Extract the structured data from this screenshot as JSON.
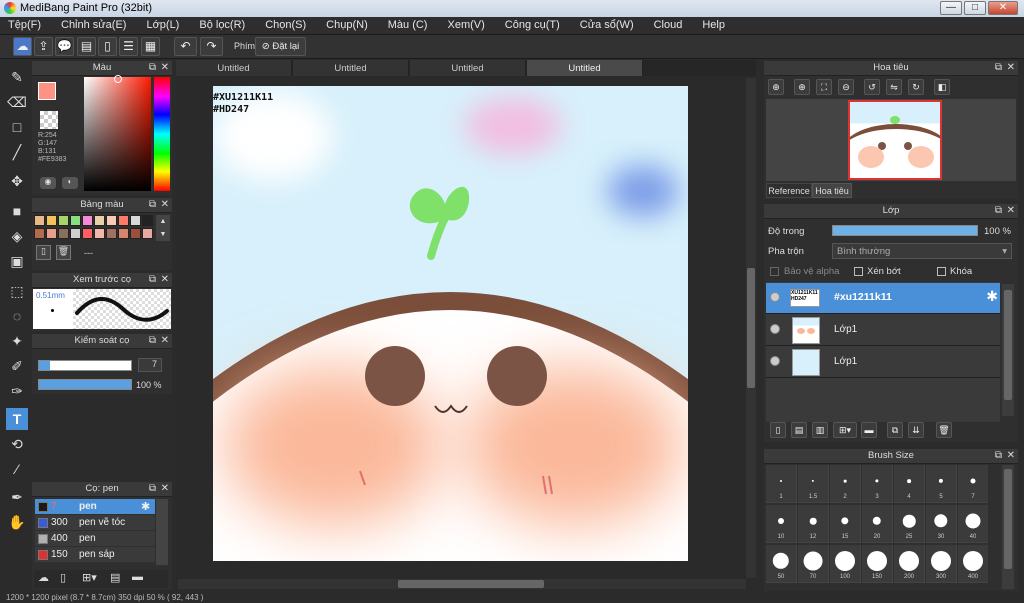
{
  "window": {
    "title": "MediBang Paint Pro (32bit)",
    "min": "—",
    "max": "□",
    "close": "✕"
  },
  "menu": [
    "Tệp(F)",
    "Chỉnh sửa(E)",
    "Lớp(L)",
    "Bộ lọc(R)",
    "Chọn(S)",
    "Chụp(N)",
    "Màu (C)",
    "Xem(V)",
    "Công cụ(T)",
    "Cửa sổ(W)",
    "Cloud",
    "Help"
  ],
  "toolbar": {
    "hotkey_label": "Phím",
    "reset_label": "Đặt lại"
  },
  "tabs": [
    "Untitled",
    "Untitled",
    "Untitled",
    "Untitled"
  ],
  "color_panel": {
    "title": "Màu",
    "r": "R:254",
    "g": "G:147",
    "b": "B:131",
    "hex": "#FE9383",
    "fg": "#FE9383"
  },
  "palette_panel": {
    "title": "Bảng màu",
    "name": "---",
    "colors": [
      "#e8b88a",
      "#f2c35a",
      "#a6d36a",
      "#85e17f",
      "#f58ad6",
      "#e9d0a8",
      "#f7c9b7",
      "#ff7a6a",
      "#d9d9d9",
      "#222222",
      "#b46b4a",
      "#ea9f8a",
      "#8a6f5a",
      "#cfcfcf",
      "#ff5f5f",
      "#f0b9a9",
      "#a07060",
      "#d9856d",
      "#9c4f3b",
      "#e8a9a0"
    ]
  },
  "brush_preview": {
    "title": "Xem trước cọ",
    "size": "0.51mm"
  },
  "brush_control": {
    "title": "Kiểm soát cọ",
    "size_value": "7",
    "opacity_value": "100 %",
    "size_fraction": 0.07,
    "opacity_fraction": 1.0
  },
  "brush_list": {
    "title": "Cọ: pen",
    "items": [
      {
        "color": "#1a1a1a",
        "size": "7",
        "name": "pen",
        "selected": true
      },
      {
        "color": "#3a5bd8",
        "size": "300",
        "name": "pen vẽ tóc",
        "selected": false
      },
      {
        "color": "#b0b0b0",
        "size": "400",
        "name": "pen",
        "selected": false
      },
      {
        "color": "#e03030",
        "size": "150",
        "name": "pen sáp",
        "selected": false
      }
    ]
  },
  "canvas": {
    "watermark1": "#XU1211K11",
    "watermark2": "#HD247"
  },
  "navigator": {
    "title": "Hoa tiêu",
    "tab_reference": "Reference",
    "tab_navigator": "Hoa tiêu"
  },
  "layer_panel": {
    "title": "Lớp",
    "opacity_label": "Độ trong",
    "opacity_value": "100 %",
    "opacity_fraction": 1.0,
    "blend_label": "Pha trộn",
    "blend_value": "Bình thường",
    "protect_alpha": "Bảo vệ alpha",
    "clipping": "Xén bớt",
    "lock": "Khóa",
    "layers": [
      {
        "name": "#xu1211k11",
        "selected": true
      },
      {
        "name": "Lớp1",
        "selected": false
      },
      {
        "name": "Lớp1",
        "selected": false
      }
    ]
  },
  "brush_size_panel": {
    "title": "Brush Size",
    "sizes": [
      "1",
      "1.5",
      "2",
      "3",
      "4",
      "5",
      "7",
      "10",
      "12",
      "15",
      "20",
      "25",
      "30",
      "40",
      "50",
      "70",
      "100",
      "150",
      "200",
      "300",
      "400"
    ]
  },
  "status": {
    "text": "1200 * 1200 pixel  (8.7 * 8.7cm)  350 dpi  50 %  ( 92, 443 )"
  }
}
